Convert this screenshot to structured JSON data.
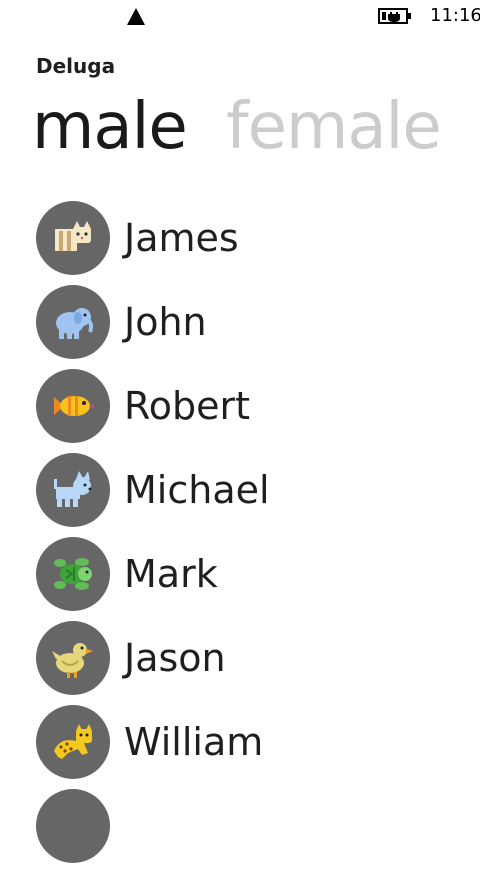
{
  "status_bar": {
    "time": "11:16",
    "signal_icon": "signal-icon",
    "battery_icon": "battery-charging-icon"
  },
  "app": {
    "title": "Deluga"
  },
  "pivot": {
    "items": [
      {
        "label": "male",
        "active": true
      },
      {
        "label": "female",
        "active": false
      }
    ]
  },
  "names": [
    {
      "name": "James",
      "icon": "cat-icon"
    },
    {
      "name": "John",
      "icon": "elephant-icon"
    },
    {
      "name": "Robert",
      "icon": "fish-icon"
    },
    {
      "name": "Michael",
      "icon": "dog-icon"
    },
    {
      "name": "Mark",
      "icon": "turtle-icon"
    },
    {
      "name": "Jason",
      "icon": "duck-icon"
    },
    {
      "name": "William",
      "icon": "leopard-icon"
    },
    {
      "name": "",
      "icon": ""
    }
  ],
  "colors": {
    "avatar_background": "#666666",
    "active_pivot": "#1a1a1a",
    "inactive_pivot": "#cccccc"
  }
}
